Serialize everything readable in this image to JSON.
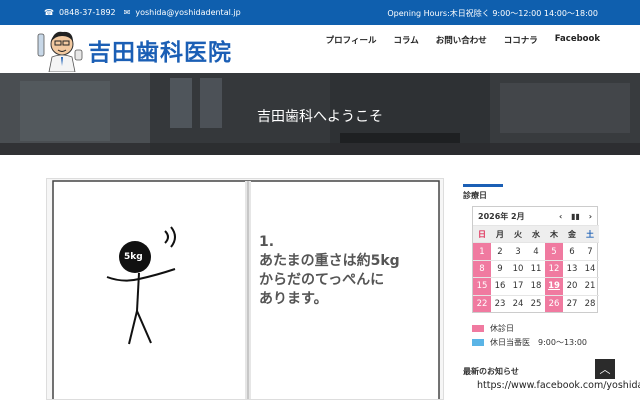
{
  "topbar": {
    "phone": "0848-37-1892",
    "email": "yoshida@yoshidadental.jp",
    "hours": "Opening Hours:木日祝除く 9:00～12:00 14:00～18:00"
  },
  "header": {
    "site_title": "吉田歯科医院",
    "nav": [
      "プロフィール",
      "コラム",
      "お問い合わせ",
      "ココナラ",
      "Facebook"
    ]
  },
  "hero": {
    "title": "吉田歯科へようこそ"
  },
  "article": {
    "weight_label": "5kg",
    "text_lines": [
      "1.",
      "あたまの重さは約5kg",
      "からだのてっぺんに",
      "あります。"
    ]
  },
  "sidebar": {
    "calendar_heading": "診療日",
    "calendar": {
      "month_label": "2026年 2月",
      "controls": [
        "‹",
        "▮▮",
        "›"
      ],
      "weekdays": [
        "日",
        "月",
        "火",
        "水",
        "木",
        "金",
        "土"
      ],
      "weeks": [
        [
          "1",
          "2",
          "3",
          "4",
          "5",
          "6",
          "7"
        ],
        [
          "8",
          "9",
          "10",
          "11",
          "12",
          "13",
          "14"
        ],
        [
          "15",
          "16",
          "17",
          "18",
          "19",
          "20",
          "21"
        ],
        [
          "22",
          "23",
          "24",
          "25",
          "26",
          "27",
          "28"
        ]
      ],
      "closed_days": [
        "1",
        "5",
        "8",
        "12",
        "15",
        "19",
        "22",
        "26"
      ],
      "today": "19"
    },
    "legend": [
      {
        "label": "休診日",
        "color": "#f07aa0"
      },
      {
        "label": "休日当番医　9:00～13:00",
        "color": "#5ab4e6"
      }
    ],
    "news_heading": "最新のお知らせ",
    "news_link": "https://www.facebook.com/yoshida"
  },
  "colors": {
    "topbar": "#0f5fae",
    "brand": "#1b5fb5",
    "closed": "#f07aa0",
    "duty": "#5ab4e6"
  },
  "icons": {
    "phone": "phone-icon",
    "email": "mail-icon",
    "scroll_top": "chevron-up-icon"
  }
}
